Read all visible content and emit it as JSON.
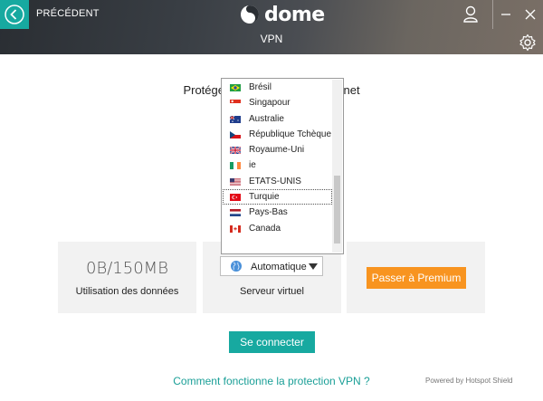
{
  "header": {
    "back_label": "PRÉCÉDENT",
    "logo_text": "dome",
    "subtitle": "VPN"
  },
  "main": {
    "headline": "Protégez votre connexion Internet"
  },
  "cards": {
    "data_usage": {
      "value": "0B/150MB",
      "caption": "Utilisation des données"
    },
    "server": {
      "selected": "Automatique",
      "caption": "Serveur virtuel"
    },
    "premium": {
      "button_label": "Passer à Premium"
    }
  },
  "dropdown": {
    "items": [
      {
        "label": "Brésil",
        "flag": "brazil-flag"
      },
      {
        "label": "Singapour",
        "flag": "singapore-flag"
      },
      {
        "label": "Australie",
        "flag": "australia-flag"
      },
      {
        "label": "République Tchèque",
        "flag": "czech-flag"
      },
      {
        "label": "Royaume-Uni",
        "flag": "uk-flag"
      },
      {
        "label": "ie",
        "flag": "ireland-flag"
      },
      {
        "label": "ETATS-UNIS",
        "flag": "usa-flag"
      },
      {
        "label": "Turquie",
        "flag": "turkey-flag",
        "selected": true
      },
      {
        "label": "Pays-Bas",
        "flag": "netherlands-flag"
      },
      {
        "label": "Canada",
        "flag": "canada-flag"
      }
    ]
  },
  "actions": {
    "connect_label": "Se connecter",
    "howto_link": "Comment fonctionne la protection VPN ?",
    "powered_by": "Powered by Hotspot Shield"
  },
  "colors": {
    "accent": "#17a9a0",
    "premium": "#f89420",
    "card_bg": "#f2f2f2"
  }
}
